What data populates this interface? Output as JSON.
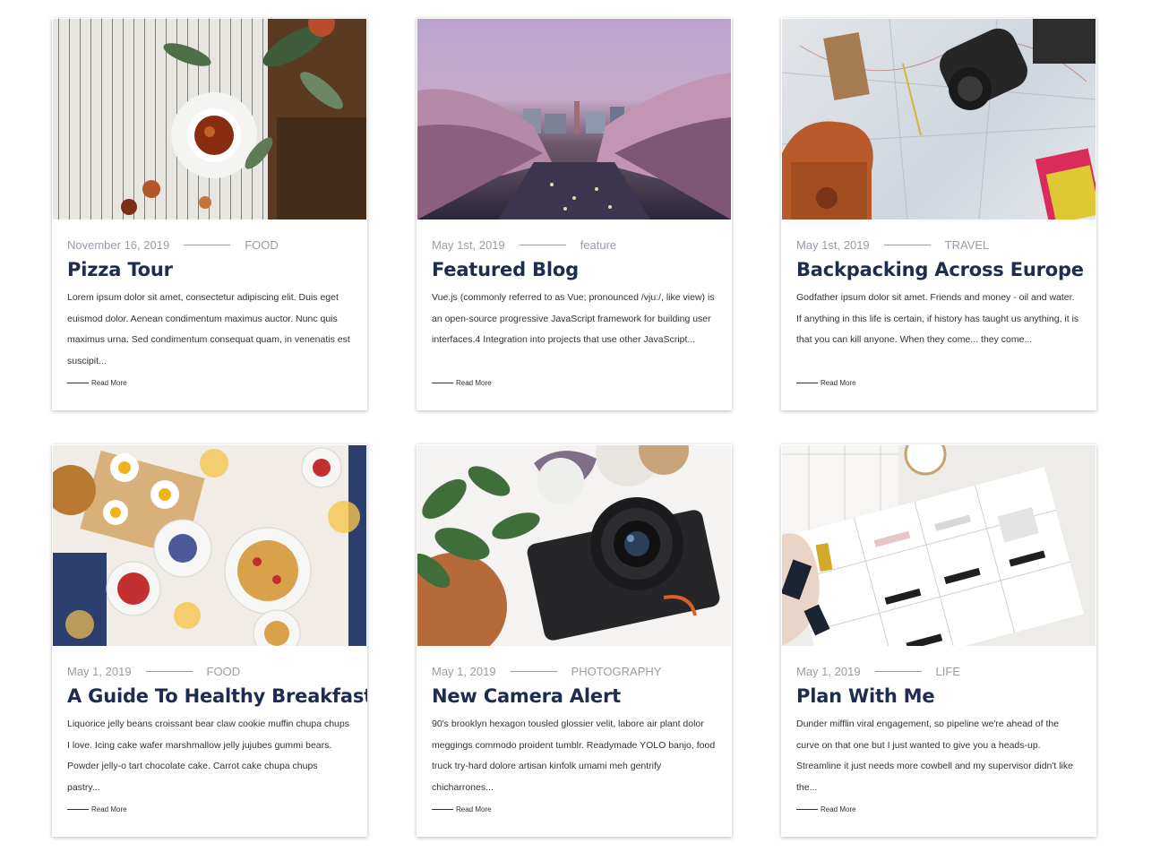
{
  "posts": [
    {
      "date": "November 16, 2019",
      "category": "FOOD",
      "title": "Pizza Tour",
      "excerpt": "Lorem ipsum dolor sit amet, consectetur adipiscing elit. Duis eget euismod dolor. Aenean condimentum maximus auctor. Nunc quis maximus urna. Sed condimentum consequat quam, in venenatis est suscipit...",
      "read_more": "Read More",
      "image": "tea-cup-on-striped-tablecloth"
    },
    {
      "date": "May 1st, 2019",
      "category": "feature",
      "title": "Featured Blog",
      "excerpt": "Vue.js (commonly referred to as Vue; pronounced /vjuː/, like view) is an open-source progressive JavaScript framework for building user interfaces.4 Integration into projects that use other JavaScript...",
      "read_more": "Read More",
      "image": "cherry-blossom-river-city"
    },
    {
      "date": "May 1st, 2019",
      "category": "TRAVEL",
      "title": "Backpacking Across Europe",
      "excerpt": "Godfather ipsum dolor sit amet. Friends and money - oil and water. If anything in this life is certain, if history has taught us anything, it is that you can kill anyone. When they come... they come...",
      "read_more": "Read More",
      "image": "map-camera-backpack"
    },
    {
      "date": "May 1, 2019",
      "category": "FOOD",
      "title": "A Guide To Healthy Breakfast",
      "excerpt": "Liquorice jelly beans croissant bear claw cookie muffin chupa chups I love. Icing cake wafer marshmallow jelly jujubes gummi bears. Powder jelly-o tart chocolate cake. Carrot cake chupa chups pastry...",
      "read_more": "Read More",
      "image": "breakfast-table-waffles"
    },
    {
      "date": "May 1, 2019",
      "category": "PHOTOGRAPHY",
      "title": "New Camera Alert",
      "excerpt": "90's brooklyn hexagon tousled glossier velit, labore air plant dolor meggings commodo proident tumblr. Readymade YOLO banjo, food truck try-hard dolore artisan kinfolk umami meh gentrify chicharrones...",
      "read_more": "Read More",
      "image": "camera-and-plant"
    },
    {
      "date": "May 1, 2019",
      "category": "LIFE",
      "title": "Plan With Me",
      "excerpt": "Dunder mifflin viral engagement, so pipeline we're ahead of the curve on that one but I just wanted to give you a heads-up. Streamline it just needs more cowbell and my supervisor didn't like the...",
      "read_more": "Read More",
      "image": "weekly-planner-notebook"
    }
  ],
  "colors": {
    "title": "#1d2c4f",
    "meta": "#9a9aa8",
    "text": "#333333"
  }
}
